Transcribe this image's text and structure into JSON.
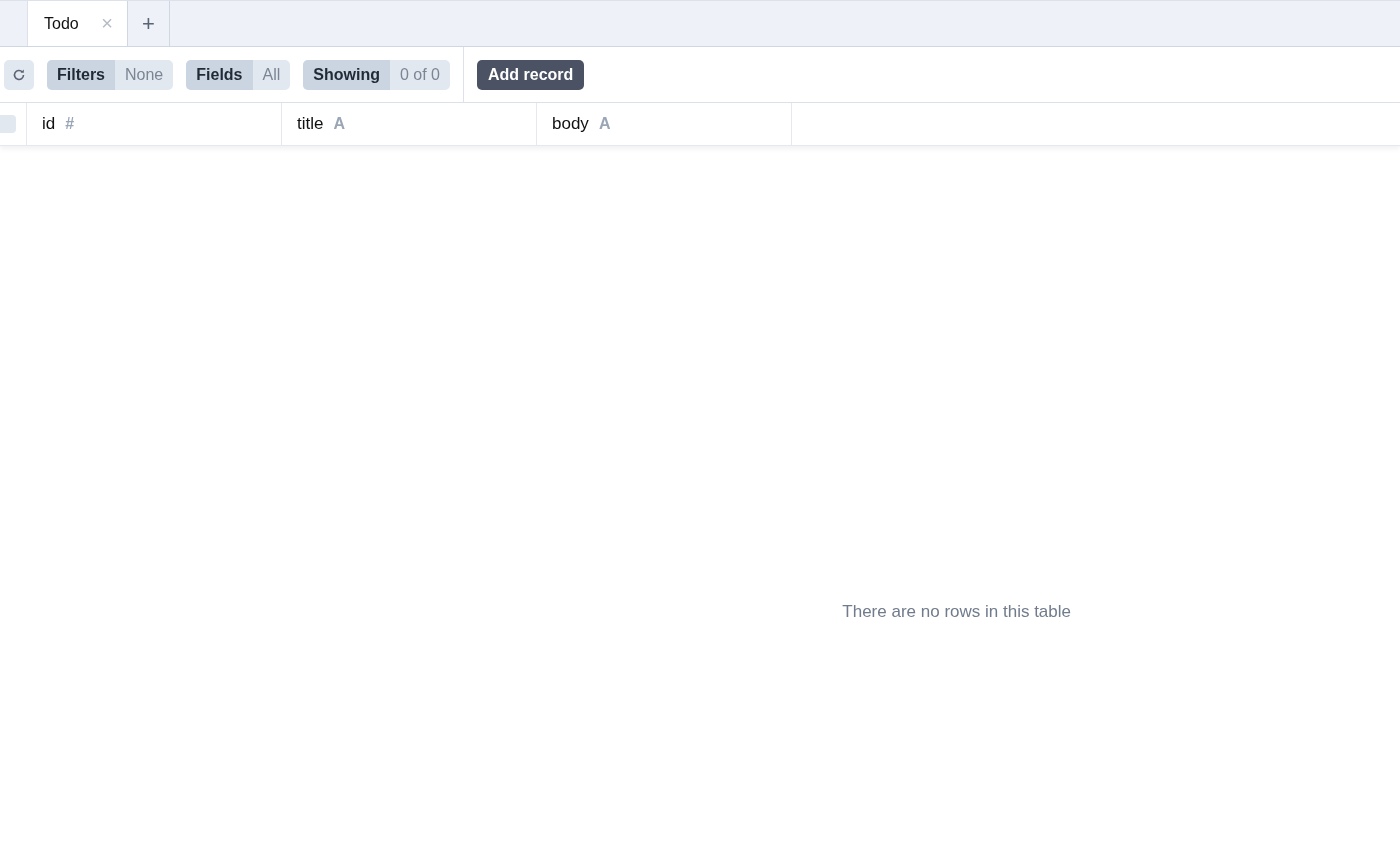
{
  "tabs": [
    {
      "label": "Todo",
      "close": "×",
      "selected": true
    }
  ],
  "new_tab": "+",
  "toolbar": {
    "groups": [
      {
        "label": "Filters",
        "value": "None"
      },
      {
        "label": "Fields",
        "value": "All"
      },
      {
        "label": "Showing",
        "value": "0 of 0"
      }
    ],
    "add_button": "Add record"
  },
  "table": {
    "select_all_checked": false,
    "columns": [
      {
        "name": "id",
        "type_glyph": "#"
      },
      {
        "name": "title",
        "type_glyph": "A"
      },
      {
        "name": "body",
        "type_glyph": "A"
      }
    ],
    "empty_message": "There are no rows in this table"
  }
}
